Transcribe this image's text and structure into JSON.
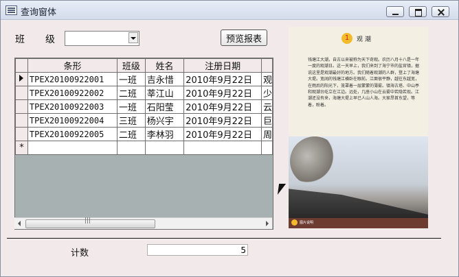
{
  "window": {
    "title": "查询窗体",
    "icon": "form-icon"
  },
  "toolbar": {
    "class_label": "班级",
    "class_value": "",
    "preview_button": "预览报表"
  },
  "table": {
    "headers": [
      "条形",
      "班级",
      "姓名",
      "注册日期"
    ],
    "rows": [
      [
        "TPEX20100922001",
        "一班",
        "吉永惜",
        "2010年9月22日"
      ],
      [
        "TPEX20100922002",
        "二班",
        "莘江山",
        "2010年9月22日"
      ],
      [
        "TPEX20100922003",
        "一班",
        "石阳莹",
        "2010年9月22日"
      ],
      [
        "TPEX20100922004",
        "三班",
        "杨兴宇",
        "2010年9月22日"
      ],
      [
        "TPEX20100922005",
        "二班",
        "李林羽",
        "2010年9月22日"
      ]
    ],
    "new_record_marker": "*",
    "selected_row": 0
  },
  "image_panel": {
    "chapter_number": "1",
    "chapter_title": "观 潮",
    "paragraph": "钱塘江大潮，自古以来被称为天下奇观。农历八月十八是一年一度的观潮日。这一天早上，我们来到了海宁市的盐官镇，据说这里是观潮最好的地方。我们随着观潮的人群，登上了海塘大堤。宽阔的钱塘江横卧在眼前。江面很平静，越往东越宽，在雨后的阳光下，笼罩着一层蒙蒙的薄雾。镇海古塔、中山亭和观潮台屹立在江边。远处，几座小山在云雾中若隐若现。江潮还没有来，海塘大堤上早已人山人海。大家昂首东望，等着，盼着。",
    "caption": "图片说明"
  },
  "footer": {
    "count_label": "计数",
    "count_value": "5"
  },
  "colors": {
    "background": "#f2eaea",
    "grid_background": "#a8b1b1",
    "accent": "#f3bb2a"
  }
}
